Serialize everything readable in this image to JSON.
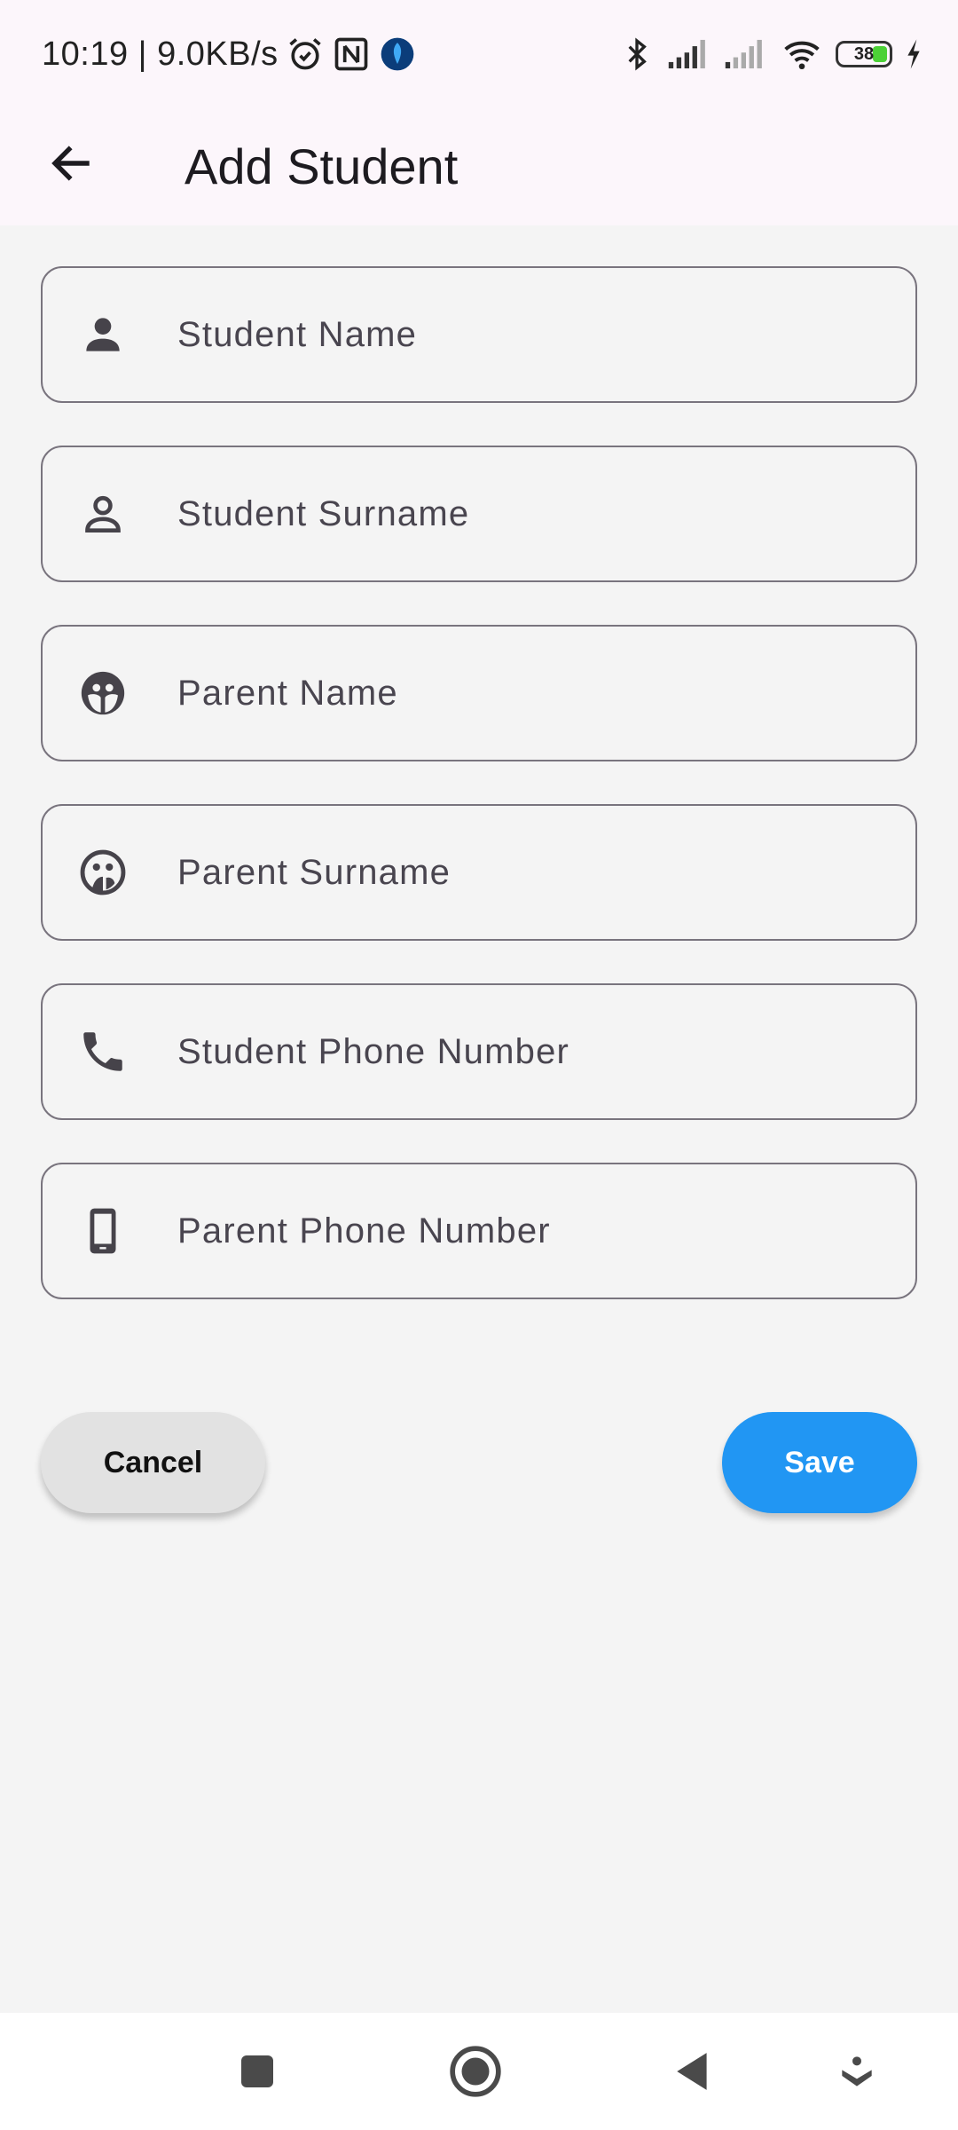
{
  "status_bar": {
    "time_speed": "10:19 | 9.0KB/s",
    "battery_level": "38",
    "icons_left": [
      "alarm-icon",
      "nfc-icon",
      "app-notification-icon"
    ],
    "icons_right": [
      "bluetooth-icon",
      "signal-icon",
      "signal-icon",
      "wifi-icon",
      "battery-icon",
      "charging-icon"
    ]
  },
  "app_bar": {
    "title": "Add Student",
    "back_icon": "arrow-back-icon"
  },
  "form": {
    "fields": [
      {
        "placeholder": "Student Name",
        "value": "",
        "icon": "person-icon"
      },
      {
        "placeholder": "Student Surname",
        "value": "",
        "icon": "person-outline-icon"
      },
      {
        "placeholder": "Parent Name",
        "value": "",
        "icon": "face-icon"
      },
      {
        "placeholder": "Parent Surname",
        "value": "",
        "icon": "face-outline-icon"
      },
      {
        "placeholder": "Student Phone Number",
        "value": "",
        "icon": "phone-icon"
      },
      {
        "placeholder": "Parent Phone Number",
        "value": "",
        "icon": "smartphone-icon"
      }
    ]
  },
  "actions": {
    "cancel_label": "Cancel",
    "save_label": "Save"
  },
  "colors": {
    "accent": "#2196f3",
    "app_bar_bg": "#fcf6fb",
    "page_bg": "#f4f4f4",
    "field_border": "#79747e",
    "battery_fill": "#4cd137"
  },
  "system_nav": {
    "buttons": [
      "recents-square-icon",
      "home-circle-icon",
      "back-triangle-icon",
      "assistant-icon"
    ]
  }
}
